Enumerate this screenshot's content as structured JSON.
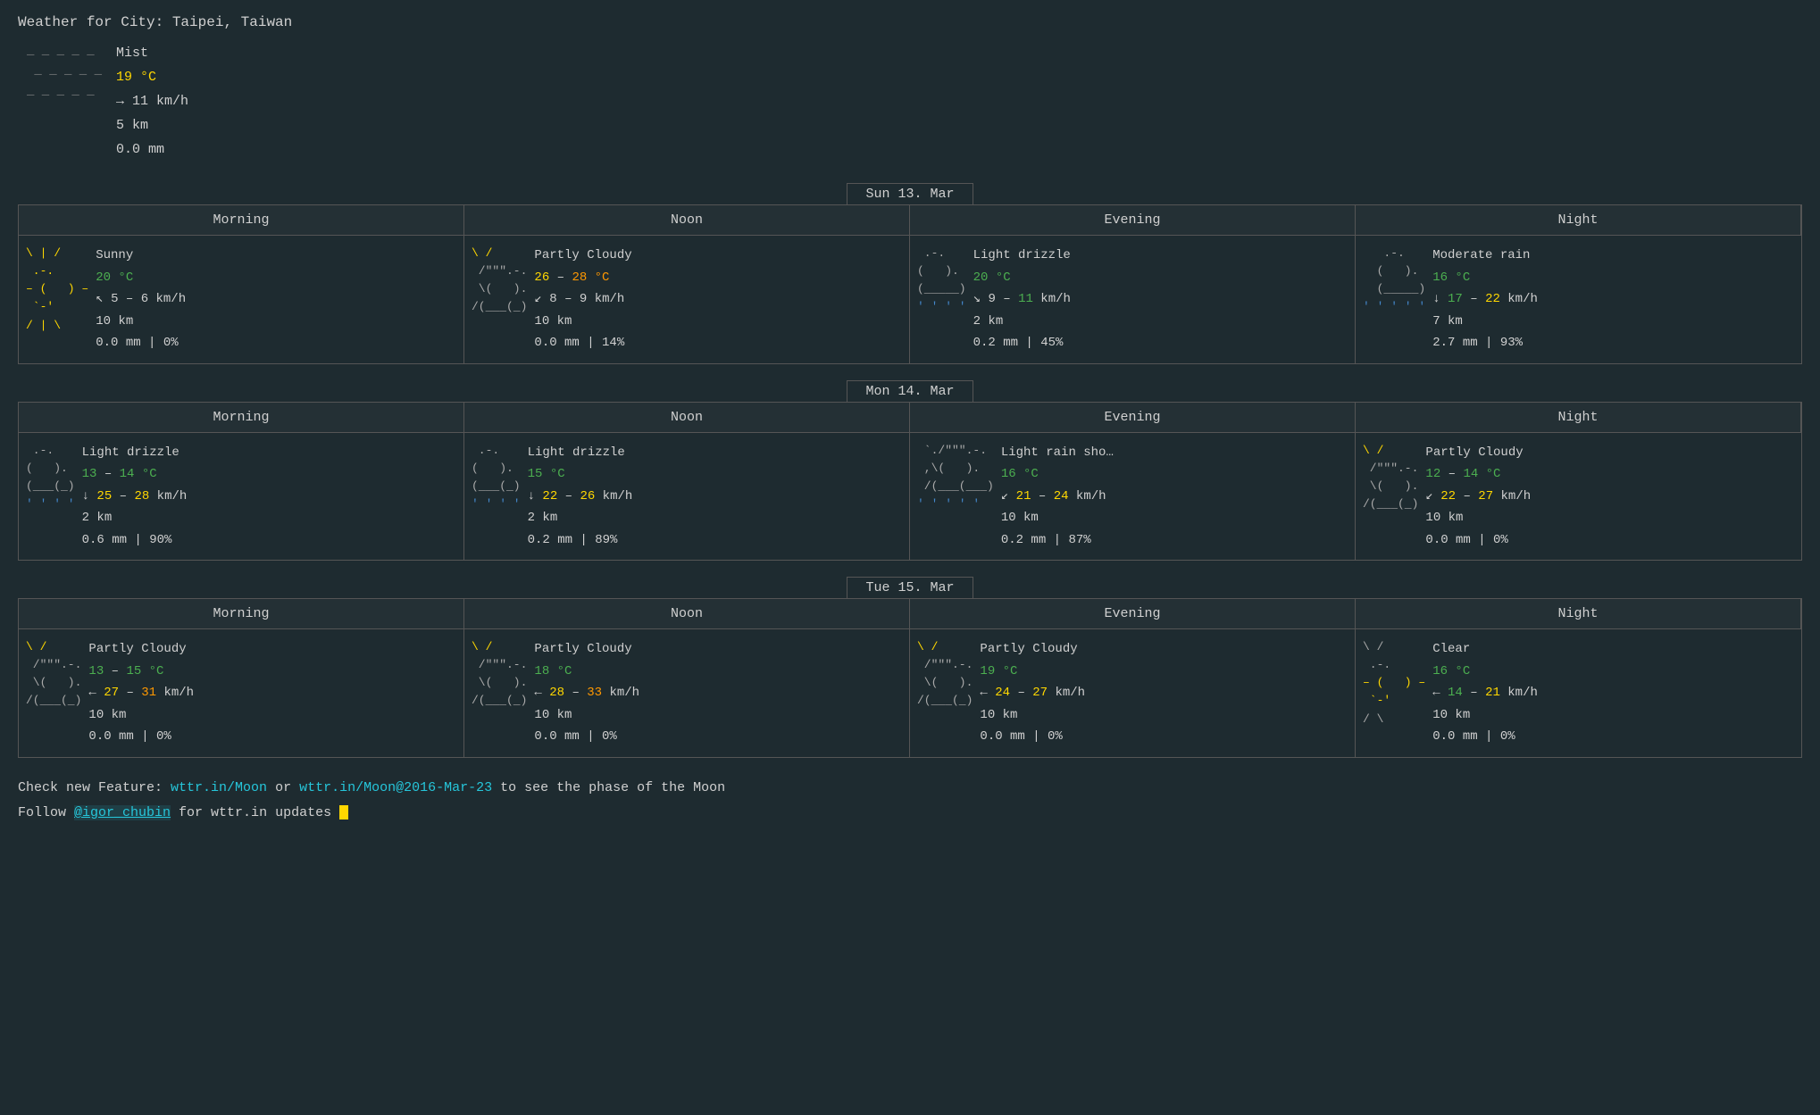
{
  "header": {
    "title": "Weather for City: Taipei, Taiwan"
  },
  "current": {
    "icon": "_ _ _ _ _\n _ _ _ _ _\n_ _ _ _ _",
    "condition": "Mist",
    "temp": "19 °C",
    "wind": "→ 11 km/h",
    "visibility": "5 km",
    "precip": "0.0 mm"
  },
  "days": [
    {
      "label": "Sun 13. Mar",
      "periods": [
        {
          "name": "Morning",
          "icon_lines": [
            "\\ | /",
            " .-.",
            "– (   ) –",
            " `-'",
            "/ | \\"
          ],
          "icon_type": "sunny",
          "condition": "Sunny",
          "temp": "20 °C",
          "temp_color": "green",
          "wind": "↖ 5 – 6 km/h",
          "wind_colors": [
            "white",
            "white",
            "white"
          ],
          "vis": "10 km",
          "precip": "0.0 mm | 0%"
        },
        {
          "name": "Noon",
          "icon_lines": [
            "\\ /",
            " /\"\"\".–.",
            " \\(   ).",
            "/(___(___)"
          ],
          "icon_type": "partly_cloudy",
          "condition": "Partly Cloudy",
          "temp": "26 – 28 °C",
          "temp_color": "yellow_orange",
          "wind": "↙ 8 – 9 km/h",
          "vis": "10 km",
          "precip": "0.0 mm | 14%"
        },
        {
          "name": "Evening",
          "icon_lines": [
            " .-.",
            "(   ).",
            "(_____)"
          ],
          "icon_type": "light_drizzle_cloud",
          "condition": "Light drizzle",
          "temp": "20 °C",
          "temp_color": "green",
          "wind": "↘ 9 – 11 km/h",
          "wind_colors": [
            "white",
            "green",
            "white",
            "orange"
          ],
          "vis": "2 km",
          "precip": "0.2 mm | 45%"
        },
        {
          "name": "Night",
          "icon_lines": [
            "   .-.",
            "  (   ).",
            "  (_____)",
            "' ' ' ' '"
          ],
          "icon_type": "moderate_rain",
          "condition": "Moderate rain",
          "temp": "16 °C",
          "temp_color": "green",
          "wind": "↓ 17 – 22 km/h",
          "wind_colors": [
            "white",
            "yellow",
            "white",
            "yellow"
          ],
          "vis": "7 km",
          "precip": "2.7 mm | 93%"
        }
      ]
    },
    {
      "label": "Mon 14. Mar",
      "periods": [
        {
          "name": "Morning",
          "icon_lines": [
            " .-.",
            "(   ).",
            "(___(__)",
            "' ' ' '"
          ],
          "icon_type": "light_drizzle",
          "condition": "Light drizzle",
          "temp": "13 – 14 °C",
          "temp_color": "green_green",
          "wind": "↓ 25 – 28 km/h",
          "wind_colors": [
            "white",
            "orange",
            "white",
            "orange"
          ],
          "vis": "2 km",
          "precip": "0.6 mm | 90%"
        },
        {
          "name": "Noon",
          "icon_lines": [
            " .-.",
            "(   ).",
            "(___(___)",
            "' ' ' '"
          ],
          "icon_type": "light_drizzle",
          "condition": "Light drizzle",
          "temp": "15 °C",
          "temp_color": "green",
          "wind": "↓ 22 – 26 km/h",
          "wind_colors": [
            "white",
            "yellow",
            "white",
            "orange"
          ],
          "vis": "2 km",
          "precip": "0.2 mm | 89%"
        },
        {
          "name": "Evening",
          "icon_lines": [
            " `./\"\"\".-.",
            " ,\\(   ).",
            " /(___(___)",
            "' ' ' ' '"
          ],
          "icon_type": "light_rain_shower",
          "condition": "Light rain sho…",
          "temp": "16 °C",
          "temp_color": "green",
          "wind": "↙ 21 – 24 km/h",
          "wind_colors": [
            "white",
            "yellow",
            "white",
            "yellow"
          ],
          "vis": "10 km",
          "precip": "0.2 mm | 87%"
        },
        {
          "name": "Night",
          "icon_lines": [
            "\\ /",
            " /\"\"\".–.",
            " \\(   ).",
            "/(___(___)"
          ],
          "icon_type": "partly_cloudy",
          "condition": "Partly Cloudy",
          "temp": "12 – 14 °C",
          "temp_color": "green_green",
          "wind": "↙ 22 – 27 km/h",
          "wind_colors": [
            "white",
            "yellow",
            "white",
            "yellow"
          ],
          "vis": "10 km",
          "precip": "0.0 mm | 0%"
        }
      ]
    },
    {
      "label": "Tue 15. Mar",
      "periods": [
        {
          "name": "Morning",
          "icon_lines": [
            "\\ /",
            " /\"\"\".–.",
            " \\(   ).",
            "/(___(___)"
          ],
          "icon_type": "partly_cloudy",
          "condition": "Partly Cloudy",
          "temp": "13 – 15 °C",
          "temp_color": "green_green",
          "wind": "← 27 – 31 km/h",
          "wind_colors": [
            "white",
            "orange",
            "white",
            "orange"
          ],
          "vis": "10 km",
          "precip": "0.0 mm | 0%"
        },
        {
          "name": "Noon",
          "icon_lines": [
            "\\ /",
            " /\"\"\".–.",
            " \\(   ).",
            "/(___(___)"
          ],
          "icon_type": "partly_cloudy",
          "condition": "Partly Cloudy",
          "temp": "18 °C",
          "temp_color": "green",
          "wind": "← 28 – 33 km/h",
          "wind_colors": [
            "white",
            "orange",
            "white",
            "red"
          ],
          "vis": "10 km",
          "precip": "0.0 mm | 0%"
        },
        {
          "name": "Evening",
          "icon_lines": [
            "\\ /",
            " /\"\"\".–.",
            " \\(   ).",
            "/(___(___)"
          ],
          "icon_type": "partly_cloudy",
          "condition": "Partly Cloudy",
          "temp": "19 °C",
          "temp_color": "green",
          "wind": "← 24 – 27 km/h",
          "wind_colors": [
            "white",
            "yellow",
            "white",
            "yellow"
          ],
          "vis": "10 km",
          "precip": "0.0 mm | 0%"
        },
        {
          "name": "Night",
          "icon_lines": [
            "\\ /",
            " .-.",
            "– (   ) –",
            " `–'",
            "/ \\"
          ],
          "icon_type": "clear",
          "condition": "Clear",
          "temp": "16 °C",
          "temp_color": "green",
          "wind": "← 14 – 21 km/h",
          "wind_colors": [
            "white",
            "green",
            "white",
            "yellow"
          ],
          "vis": "10 km",
          "precip": "0.0 mm | 0%"
        }
      ]
    }
  ],
  "footer": {
    "line1_prefix": "Check new Feature: ",
    "link1": "wttr.in/Moon",
    "line1_middle": " or ",
    "link2": "wttr.in/Moon@2016-Mar-23",
    "line1_suffix": " to see the phase of the Moon",
    "line2_prefix": "Follow ",
    "handle": "@igor_chubin",
    "line2_suffix": " for wttr.in updates"
  }
}
